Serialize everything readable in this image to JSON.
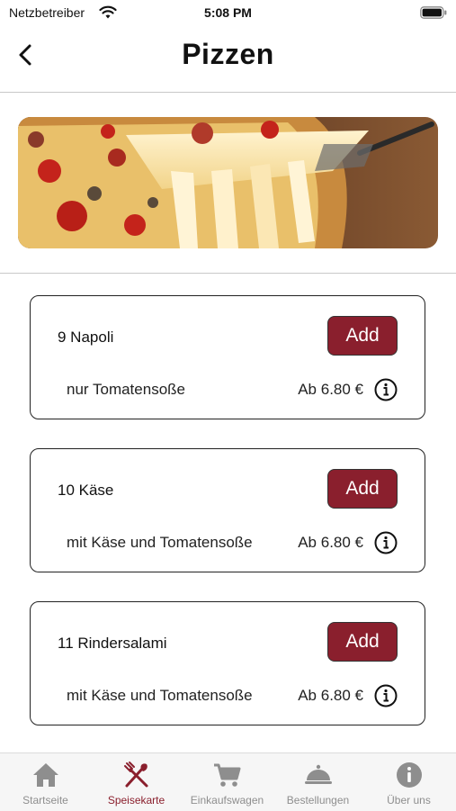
{
  "status": {
    "carrier": "Netzbetreiber",
    "time": "5:08 PM"
  },
  "header": {
    "title": "Pizzen"
  },
  "items": [
    {
      "name": "9 Napoli",
      "description": "nur Tomatensoße",
      "price": "Ab 6.80 €",
      "add_label": "Add"
    },
    {
      "name": "10 Käse",
      "description": "mit Käse und Tomatensoße",
      "price": "Ab 6.80 €",
      "add_label": "Add"
    },
    {
      "name": "11 Rindersalami",
      "description": "mit Käse und Tomatensoße",
      "price": "Ab 6.80 €",
      "add_label": "Add"
    }
  ],
  "tabs": [
    {
      "label": "Startseite",
      "icon": "home-icon",
      "active": false
    },
    {
      "label": "Speisekarte",
      "icon": "fork-knife-icon",
      "active": true
    },
    {
      "label": "Einkaufswagen",
      "icon": "cart-icon",
      "active": false
    },
    {
      "label": "Bestellungen",
      "icon": "cloche-icon",
      "active": false
    },
    {
      "label": "Über uns",
      "icon": "info-icon",
      "active": false
    }
  ],
  "colors": {
    "accent": "#8a1f2d",
    "inactive_tab": "#8e8e8e"
  }
}
